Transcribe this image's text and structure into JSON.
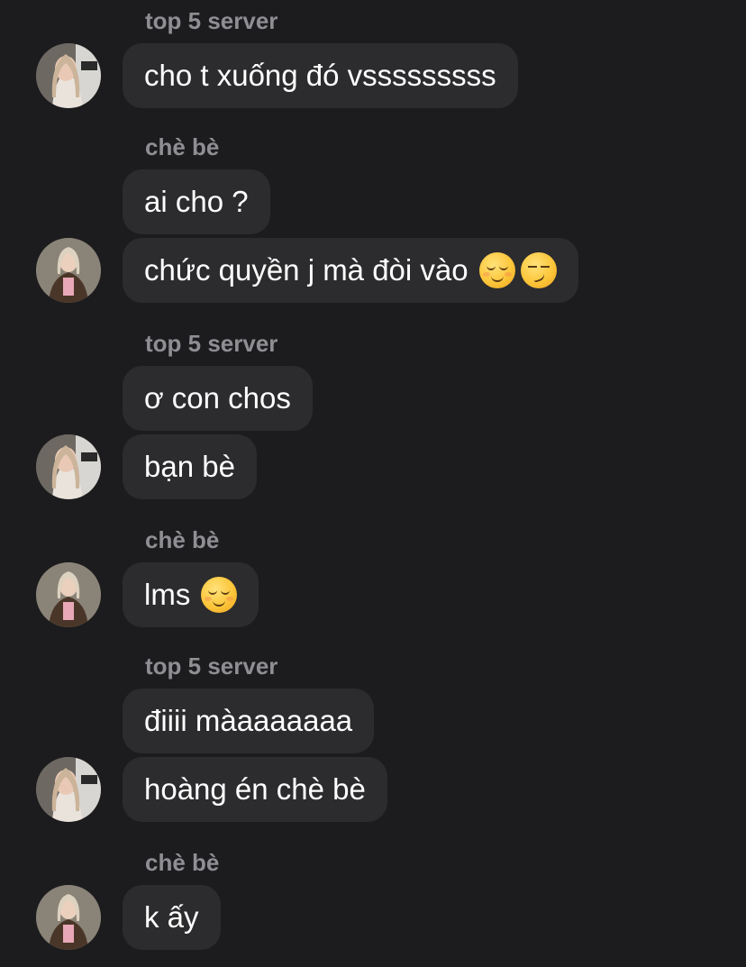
{
  "colors": {
    "background": "#1c1c1e",
    "bubble": "#2c2c2e",
    "sender_name": "#8e8e93",
    "message_text": "#ffffff"
  },
  "messages": [
    {
      "sender": "top 5 server",
      "text": "cho t xuống đó vsssssssss",
      "emoji": []
    },
    {
      "sender": "chè bè",
      "text": "ai cho ?",
      "emoji": []
    },
    {
      "sender": "chè bè",
      "text": "chức quyền j mà đòi vào",
      "emoji": [
        "relieved-face-emoji",
        "smirking-face-emoji"
      ]
    },
    {
      "sender": "top 5 server",
      "text": "ơ con chos",
      "emoji": []
    },
    {
      "sender": "top 5 server",
      "text": "bạn bè",
      "emoji": []
    },
    {
      "sender": "chè bè",
      "text": "lms",
      "emoji": [
        "relieved-face-emoji"
      ]
    },
    {
      "sender": "top 5 server",
      "text": "điiii màaaaaaaa",
      "emoji": []
    },
    {
      "sender": "top 5 server",
      "text": "hoàng én chè bè",
      "emoji": []
    },
    {
      "sender": "chè bè",
      "text": "k ấy",
      "emoji": []
    }
  ]
}
